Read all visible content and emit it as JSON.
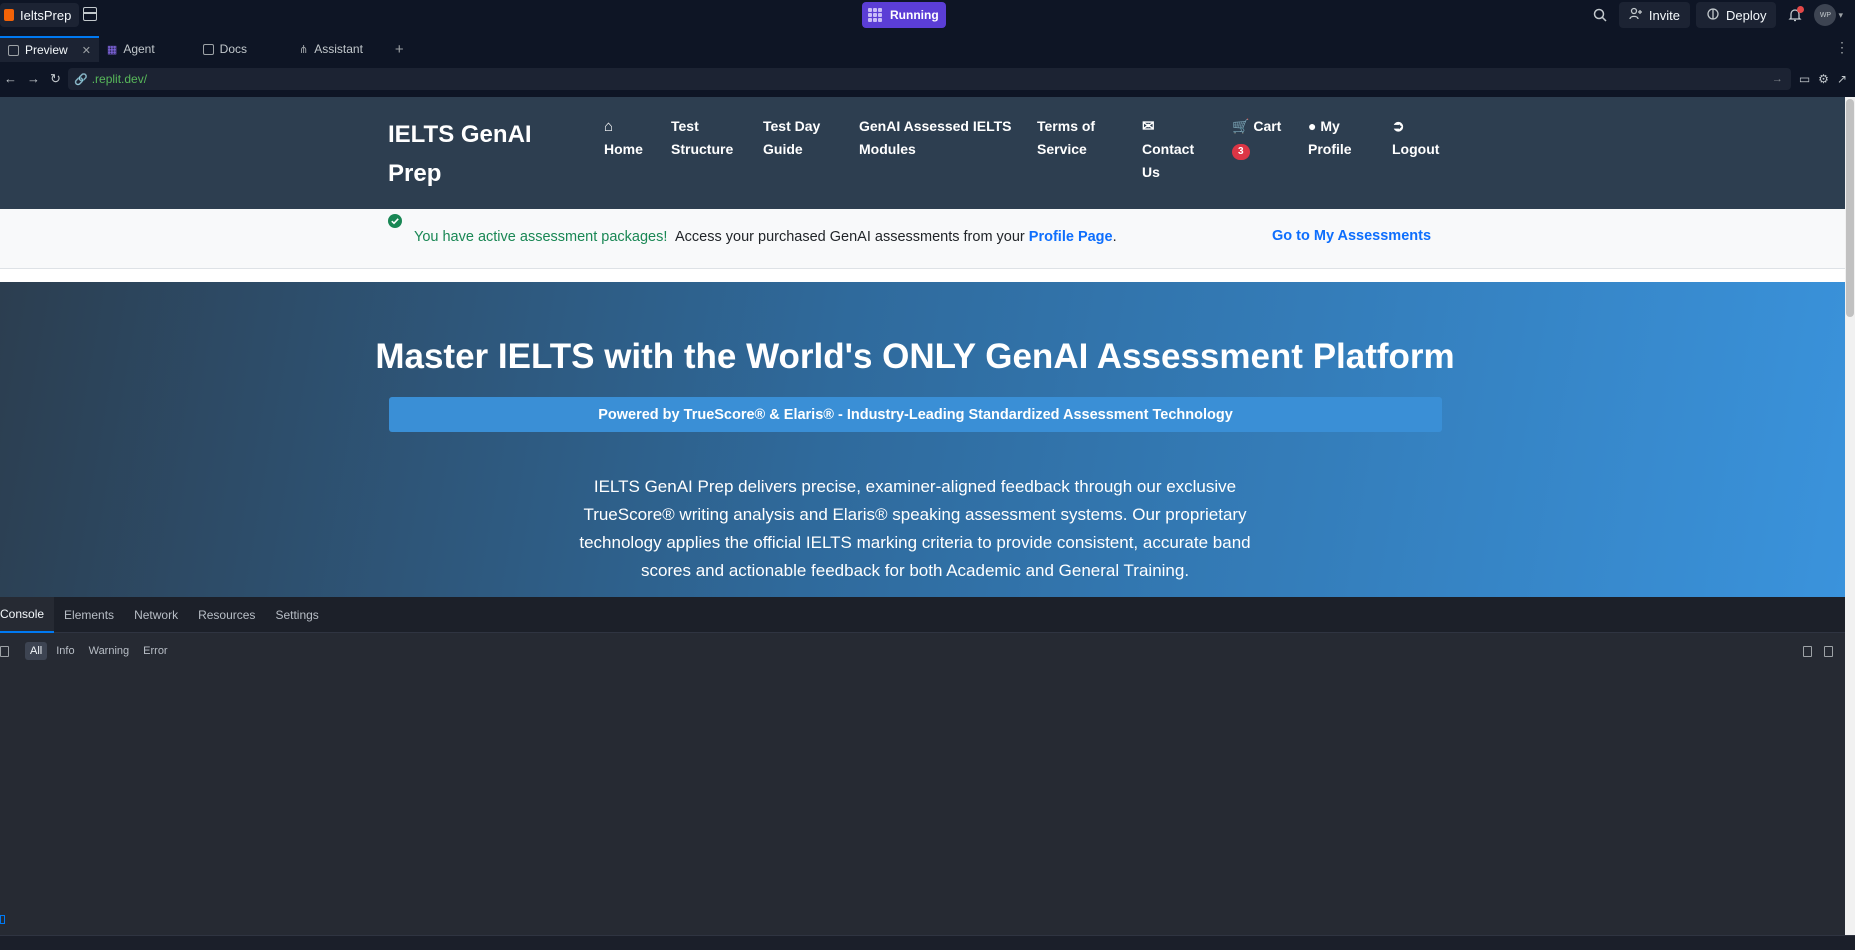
{
  "app": {
    "name": "IeltsPrep",
    "status": "Running"
  },
  "top_actions": {
    "invite": "Invite",
    "deploy": "Deploy",
    "avatar_initials": "WP"
  },
  "tabs": [
    {
      "label": "Preview"
    },
    {
      "label": "Agent"
    },
    {
      "label": "Docs"
    },
    {
      "label": "Assistant"
    }
  ],
  "url": {
    "value": ".replit.dev/"
  },
  "site": {
    "brand": "IELTS GenAI Prep",
    "nav": {
      "home": "Home",
      "test_structure": "Test Structure",
      "test_day_guide": "Test Day Guide",
      "modules": "GenAI Assessed IELTS Modules",
      "terms": "Terms of Service",
      "contact": "Contact Us",
      "cart": "Cart",
      "cart_count": "3",
      "profile": "My Profile",
      "logout": "Logout"
    },
    "alert": {
      "success": "You have active assessment packages!",
      "text": "Access your purchased GenAI assessments from your",
      "link": "Profile Page",
      "suffix": ".",
      "button": "Go to My Assessments"
    },
    "hero": {
      "title": "Master IELTS with the World's ONLY GenAI Assessment Platform",
      "badge": "Powered by TrueScore® & Elaris® - Industry-Leading Standardized Assessment Technology",
      "description": "IELTS GenAI Prep delivers precise, examiner-aligned feedback through our exclusive TrueScore® writing analysis and Elaris® speaking assessment systems. Our proprietary technology applies the official IELTS marking criteria to provide consistent, accurate band scores and actionable feedback for both Academic and General Training."
    }
  },
  "devtools": {
    "tabs": [
      "Console",
      "Elements",
      "Network",
      "Resources",
      "Settings"
    ],
    "filters": [
      "All",
      "Info",
      "Warning",
      "Error"
    ]
  },
  "colors": {
    "running": "#5b3ed6",
    "site_nav": "#2d3e50",
    "hero_start": "#2c3e50",
    "hero_end": "#3a93dc",
    "link": "#0d6efd",
    "success": "#198754",
    "badge": "#dc3545"
  }
}
